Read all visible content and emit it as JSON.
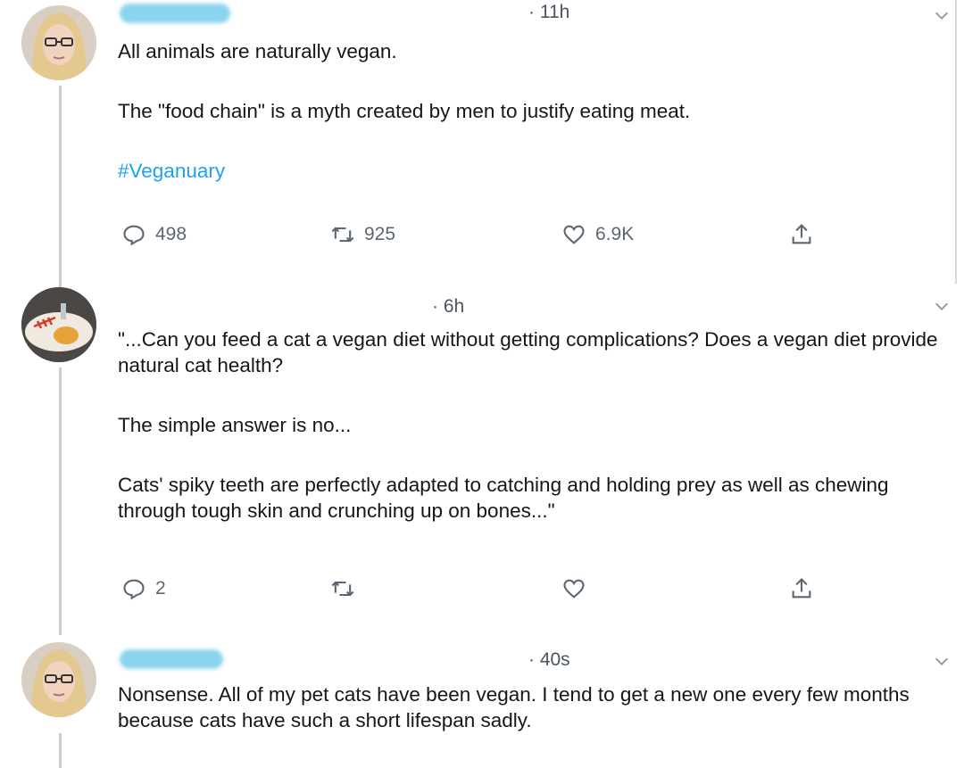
{
  "tweets": [
    {
      "time": "· 11h",
      "paragraphs": [
        "All animals are naturally vegan.",
        "The \"food chain\" is a myth created by men to justify eating meat."
      ],
      "hashtag": "#Veganuary",
      "replies": "498",
      "retweets": "925",
      "likes": "6.9K"
    },
    {
      "time": "· 6h",
      "paragraphs": [
        "\"...Can you feed a cat a vegan diet without getting complications? Does a vegan diet provide natural cat health?",
        "The simple answer is no...",
        "Cats' spiky teeth are perfectly adapted to catching and holding prey as well as chewing through tough skin and crunching up on bones...\""
      ],
      "replies": "2",
      "retweets": "",
      "likes": ""
    },
    {
      "time": "· 40s",
      "paragraphs": [
        "Nonsense. All of my pet cats have been vegan. I tend to get a new one every few months because cats have such a short lifespan sadly."
      ]
    }
  ],
  "icons": {
    "reply": "reply-icon",
    "retweet": "retweet-icon",
    "like": "heart-icon",
    "share": "share-icon",
    "caret": "chevron-down-icon"
  },
  "colors": {
    "text": "#14171a",
    "muted": "#5b6772",
    "link": "#1da1f2",
    "handle_redaction": "#7fd0ef",
    "thread_line": "#c4cfd6"
  }
}
